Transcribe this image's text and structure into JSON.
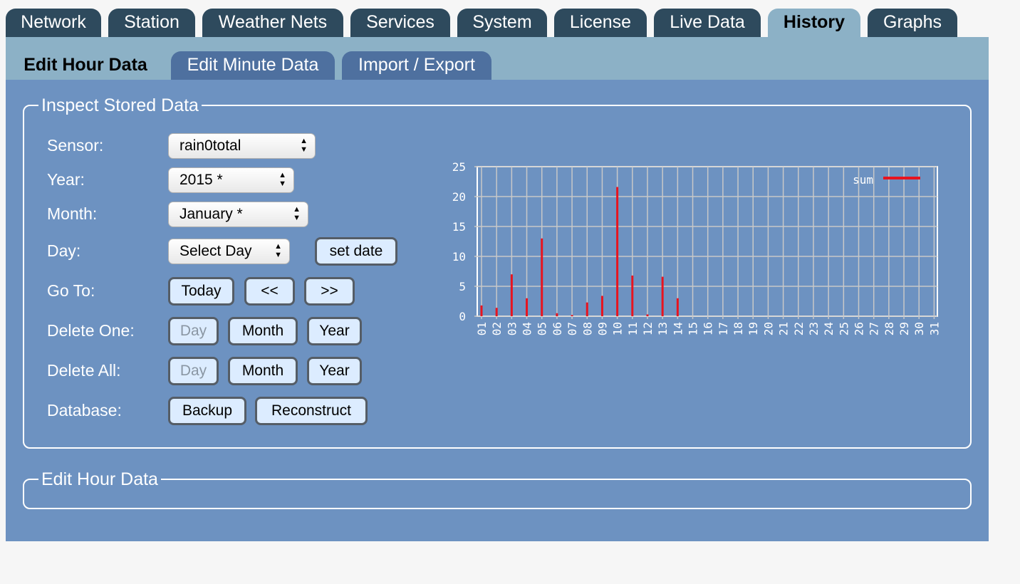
{
  "top_tabs": [
    "Network",
    "Station",
    "Weather Nets",
    "Services",
    "System",
    "License",
    "Live Data",
    "History",
    "Graphs"
  ],
  "active_top_tab": "History",
  "sub_tabs": [
    "Edit Hour Data",
    "Edit Minute Data",
    "Import / Export"
  ],
  "active_sub_tab": "Edit Hour Data",
  "inspect": {
    "legend": "Inspect Stored Data",
    "labels": {
      "sensor": "Sensor:",
      "year": "Year:",
      "month": "Month:",
      "day": "Day:",
      "goto": "Go To:",
      "delete_one": "Delete One:",
      "delete_all": "Delete All:",
      "database": "Database:"
    },
    "sensor_value": "rain0total",
    "year_value": "2015 *",
    "month_value": "January *",
    "day_value": "Select Day",
    "set_date_label": "set date",
    "today_label": "Today",
    "prev_label": "<<",
    "next_label": ">>",
    "day_label": "Day",
    "month_label": "Month",
    "year_label": "Year",
    "backup_label": "Backup",
    "reconstruct_label": "Reconstruct"
  },
  "edit_hour": {
    "legend": "Edit Hour Data"
  },
  "colors": {
    "series": "#e8141f",
    "grid": "#c8c8c8",
    "panel": "#6d92c1",
    "tab_dark": "#2e4a5d"
  },
  "chart_data": {
    "type": "bar",
    "categories": [
      "01",
      "02",
      "03",
      "04",
      "05",
      "06",
      "07",
      "08",
      "09",
      "10",
      "11",
      "12",
      "13",
      "14",
      "15",
      "16",
      "17",
      "18",
      "19",
      "20",
      "21",
      "22",
      "23",
      "24",
      "25",
      "26",
      "27",
      "28",
      "29",
      "30",
      "31"
    ],
    "series": [
      {
        "name": "sum",
        "values": [
          1.8,
          1.4,
          7.0,
          3.0,
          13.0,
          0.5,
          0.2,
          2.3,
          3.4,
          21.6,
          6.8,
          0.3,
          6.6,
          3.0,
          0,
          0,
          0,
          0,
          0,
          0,
          0,
          0,
          0,
          0,
          0,
          0,
          0,
          0,
          0,
          0,
          0
        ]
      }
    ],
    "ylim": [
      0,
      25
    ],
    "yticks": [
      0,
      5,
      10,
      15,
      20,
      25
    ],
    "grid": true,
    "legend_position": "top-right"
  }
}
